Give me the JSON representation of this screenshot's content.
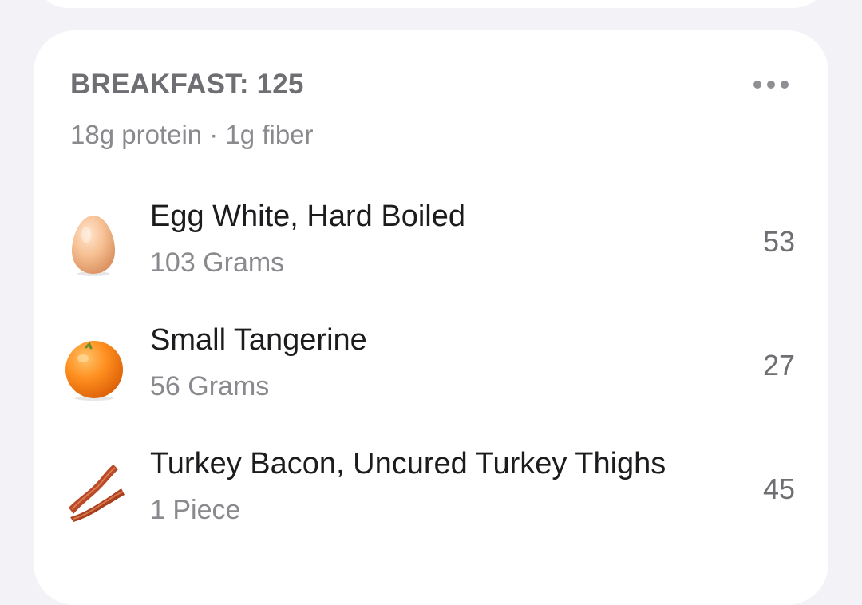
{
  "meal": {
    "title": "BREAKFAST: 125",
    "summary": "18g protein · 1g fiber",
    "more_icon": "more-horizontal-icon"
  },
  "foods": [
    {
      "name": "Egg White, Hard Boiled",
      "amount": "103 Grams",
      "calories": "53",
      "icon": "egg-icon"
    },
    {
      "name": "Small Tangerine",
      "amount": "56 Grams",
      "calories": "27",
      "icon": "tangerine-icon"
    },
    {
      "name": "Turkey Bacon, Uncured Turkey Thighs",
      "amount": "1 Piece",
      "calories": "45",
      "icon": "bacon-icon"
    }
  ],
  "colors": {
    "background": "#f2f2f7",
    "card": "#ffffff",
    "primary_text": "#1c1c1e",
    "secondary_text": "#8a8a8e",
    "header_text": "#6e6e73"
  }
}
